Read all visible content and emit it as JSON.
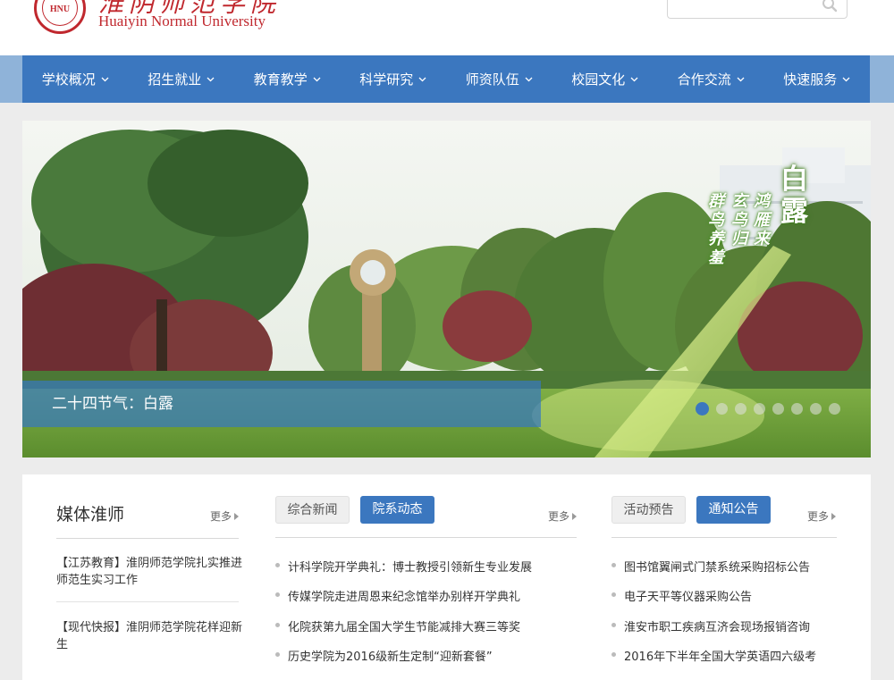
{
  "header": {
    "logo_seal_text": "HNU",
    "logo_cn": "淮阴师范学院",
    "logo_en": "Huaiyin Normal University",
    "search": {
      "placeholder": "",
      "icon": "search-icon"
    }
  },
  "nav": {
    "items": [
      {
        "label": "学校概况"
      },
      {
        "label": "招生就业"
      },
      {
        "label": "教育教学"
      },
      {
        "label": "科学研究"
      },
      {
        "label": "师资队伍"
      },
      {
        "label": "校园文化"
      },
      {
        "label": "合作交流"
      },
      {
        "label": "快速服务"
      }
    ]
  },
  "banner": {
    "caption": "二十四节气：白露",
    "poem_title": "白露",
    "poem_lines": [
      "鸿雁来",
      "玄鸟归",
      "群鸟养羞"
    ],
    "slide_count": 8,
    "active_slide": 1
  },
  "media": {
    "title": "媒体淮师",
    "more": "更多",
    "items": [
      "【江苏教育】淮阴师范学院扎实推进师范生实习工作",
      "【现代快报】淮阴师范学院花样迎新生"
    ]
  },
  "news": {
    "tabs": [
      "综合新闻",
      "院系动态"
    ],
    "active_tab": 1,
    "more": "更多",
    "items": [
      "计科学院开学典礼：博士教授引领新生专业发展",
      "传媒学院走进周恩来纪念馆举办别样开学典礼",
      "化院获第九届全国大学生节能减排大赛三等奖",
      "历史学院为2016级新生定制“迎新套餐”"
    ]
  },
  "notices": {
    "tabs": [
      "活动预告",
      "通知公告"
    ],
    "active_tab": 1,
    "more": "更多",
    "items": [
      "图书馆翼闸式门禁系统采购招标公告",
      "电子天平等仪器采购公告",
      "淮安市职工疾病互济会现场报销咨询",
      "2016年下半年全国大学英语四六级考"
    ]
  },
  "colors": {
    "brand_red": "#c0282e",
    "nav_blue": "#3b77bf",
    "nav_outer": "#8fb3d9",
    "page_bg": "#ececec"
  }
}
